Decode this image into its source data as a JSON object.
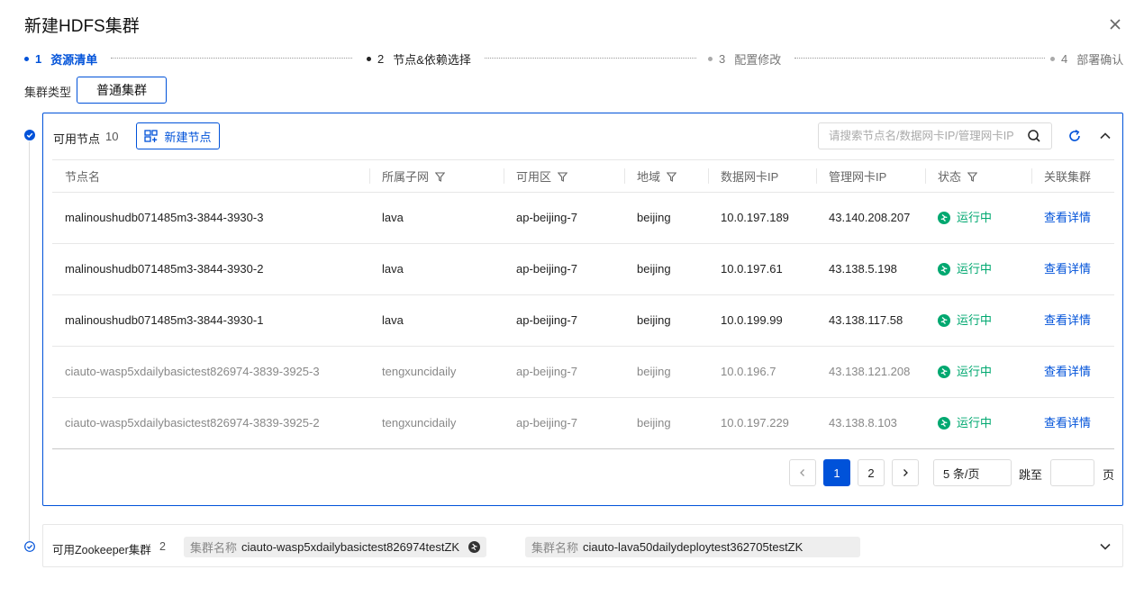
{
  "dialog": {
    "title": "新建HDFS集群"
  },
  "steps": [
    {
      "num": "1",
      "label": "资源清单"
    },
    {
      "num": "2",
      "label": "节点&依赖选择"
    },
    {
      "num": "3",
      "label": "配置修改"
    },
    {
      "num": "4",
      "label": "部署确认"
    }
  ],
  "cluster_type": {
    "label": "集群类型",
    "value": "普通集群"
  },
  "nodes_panel": {
    "title": "可用节点",
    "count": "10",
    "new_button": "新建节点",
    "search_placeholder": "请搜索节点名/数据网卡IP/管理网卡IP",
    "columns": [
      "节点名",
      "所属子网",
      "可用区",
      "地域",
      "数据网卡IP",
      "管理网卡IP",
      "状态",
      "关联集群"
    ],
    "rows": [
      {
        "name": "malinoushudb071485m3-3844-3930-3",
        "subnet": "lava",
        "zone": "ap-beijing-7",
        "region": "beijing",
        "data_ip": "10.0.197.189",
        "mgmt_ip": "43.140.208.207",
        "status": "运行中",
        "action": "查看详情"
      },
      {
        "name": "malinoushudb071485m3-3844-3930-2",
        "subnet": "lava",
        "zone": "ap-beijing-7",
        "region": "beijing",
        "data_ip": "10.0.197.61",
        "mgmt_ip": "43.138.5.198",
        "status": "运行中",
        "action": "查看详情"
      },
      {
        "name": "malinoushudb071485m3-3844-3930-1",
        "subnet": "lava",
        "zone": "ap-beijing-7",
        "region": "beijing",
        "data_ip": "10.0.199.99",
        "mgmt_ip": "43.138.117.58",
        "status": "运行中",
        "action": "查看详情"
      },
      {
        "name": "ciauto-wasp5xdailybasictest826974-3839-3925-3",
        "subnet": "tengxuncidaily",
        "zone": "ap-beijing-7",
        "region": "beijing",
        "data_ip": "10.0.196.7",
        "mgmt_ip": "43.138.121.208",
        "status": "运行中",
        "action": "查看详情"
      },
      {
        "name": "ciauto-wasp5xdailybasictest826974-3839-3925-2",
        "subnet": "tengxuncidaily",
        "zone": "ap-beijing-7",
        "region": "beijing",
        "data_ip": "10.0.197.229",
        "mgmt_ip": "43.138.8.103",
        "status": "运行中",
        "action": "查看详情"
      }
    ],
    "pagination": {
      "pages": [
        "1",
        "2"
      ],
      "current": "1",
      "page_size": "5 条/页",
      "jump_label": "跳至",
      "page_suffix": "页"
    }
  },
  "zookeeper_panel": {
    "title": "可用Zookeeper集群",
    "count": "2",
    "tags": [
      {
        "key": "集群名称",
        "value": "ciauto-wasp5xdailybasictest826974testZK"
      },
      {
        "key": "集群名称",
        "value": "ciauto-lava50dailydeploytest362705testZK"
      }
    ]
  },
  "colors": {
    "primary": "#0052d9",
    "success": "#00a870",
    "border": "#e7e7e7"
  }
}
